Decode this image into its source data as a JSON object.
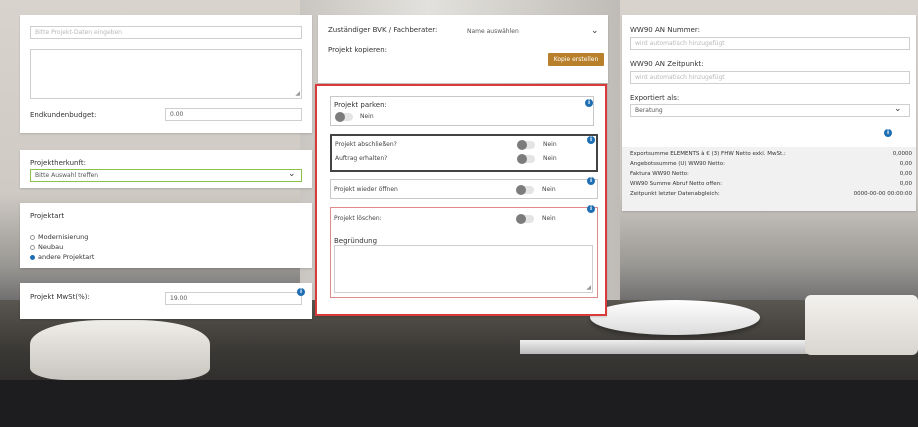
{
  "theme": {
    "accent": "#1f6fb5",
    "red_frame": "#d93a3a",
    "button": "#b8802a"
  },
  "left": {
    "project_data_placeholder": "Bitte Projekt-Daten eingeben",
    "budget_label": "Endkundenbudget:",
    "budget_value": "0.00",
    "herkunft_label": "Projektherkunft:",
    "herkunft_value": "Bitte Auswahl treffen",
    "art_label": "Projektart",
    "art_options": [
      "Modernisierung",
      "Neubau",
      "andere Projektart"
    ],
    "art_selected": "andere Projektart",
    "mwst_label": "Projekt MwSt(%):",
    "mwst_value": "19.00"
  },
  "middle": {
    "bvk_label": "Zuständiger BVK / Fachberater:",
    "bvk_value": "Name auswählen",
    "copy_label": "Projekt kopieren:",
    "copy_button": "Kopie erstellen",
    "park_label": "Projekt parken:",
    "park_value": "Nein",
    "close_label": "Projekt abschließen?",
    "close_value": "Nein",
    "order_label": "Auftrag erhalten?",
    "order_value": "Nein",
    "reopen_label": "Projekt wieder öffnen",
    "reopen_value": "Nein",
    "delete_label": "Projekt löschen:",
    "delete_value": "Nein",
    "reason_label": "Begründung"
  },
  "right": {
    "number_label": "WW90 AN Nummer:",
    "number_placeholder": "wird automatisch hinzugefügt",
    "time_label": "WW90 AN Zeitpunkt:",
    "time_placeholder": "wird automatisch hinzugefügt",
    "export_label": "Exportiert als:",
    "export_value": "Beratung",
    "summary": [
      {
        "label": "Exportsumme ELEMENTS à € (3) FHW Netto exkl. MwSt.:",
        "value": "0,0000"
      },
      {
        "label": "Angebotssumme (U) WW90 Netto:",
        "value": "0,00"
      },
      {
        "label": "Faktura WW90 Netto:",
        "value": "0,00"
      },
      {
        "label": "WW90 Summe Abruf Netto offen:",
        "value": "0,00"
      },
      {
        "label": "Zeitpunkt letzter Datenabgleich:",
        "value": "0000-00-00 00:00:00"
      }
    ]
  },
  "icons": {
    "info": "info-icon",
    "chevron": "chevron-down-icon",
    "resize": "resize-grip-icon"
  }
}
